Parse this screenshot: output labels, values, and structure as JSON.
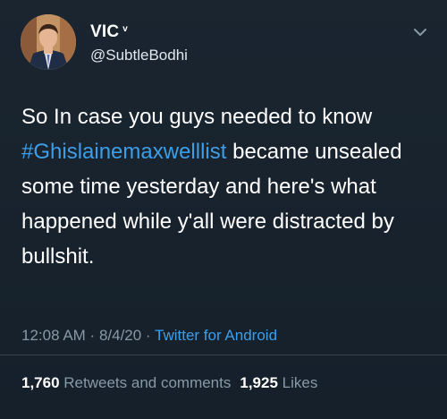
{
  "user": {
    "display_name": "VIC",
    "verified_mark": "v",
    "handle": "@SubtleBodhi",
    "avatar_icon": "profile-photo"
  },
  "tweet": {
    "line1": "So In case you guys needed to know",
    "hashtag": "#Ghislainemaxwelllist",
    "rest": " became unsealed some time yesterday and here's what happened while y'all were distracted by bullshit."
  },
  "meta": {
    "time": "12:08 AM",
    "sep1": " · ",
    "date": "8/4/20",
    "sep2": " · ",
    "source": "Twitter for Android"
  },
  "stats": {
    "retweets_count": "1,760",
    "retweets_label": "Retweets and comments",
    "likes_count": "1,925",
    "likes_label": "Likes"
  },
  "colors": {
    "background": "#15202b",
    "accent": "#3d9ee8",
    "secondary_text": "#8899a6"
  }
}
